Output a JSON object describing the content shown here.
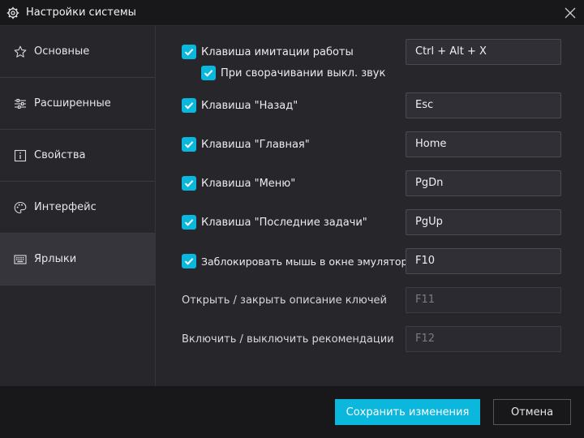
{
  "window": {
    "title": "Настройки системы",
    "icons": {
      "settings": "gear-icon",
      "close": "close-icon"
    }
  },
  "sidebar": {
    "items": [
      {
        "label": "Основные",
        "icon": "star-icon",
        "active": false
      },
      {
        "label": "Расширенные",
        "icon": "sliders-icon",
        "active": false
      },
      {
        "label": "Свойства",
        "icon": "info-icon",
        "active": false
      },
      {
        "label": "Интерфейс",
        "icon": "palette-icon",
        "active": false
      },
      {
        "label": "Ярлыки",
        "icon": "keyboard-icon",
        "active": true
      }
    ]
  },
  "shortcuts": {
    "boss_key": {
      "label": "Клавиша имитации работы",
      "checked": true,
      "value": "Ctrl + Alt + X"
    },
    "mute_on_minimize": {
      "label": "При сворачивании выкл. звук",
      "checked": true
    },
    "back": {
      "label": "Клавиша \"Назад\"",
      "checked": true,
      "value": "Esc"
    },
    "home": {
      "label": "Клавиша \"Главная\"",
      "checked": true,
      "value": "Home"
    },
    "menu": {
      "label": "Клавиша \"Меню\"",
      "checked": true,
      "value": "PgDn"
    },
    "recent": {
      "label": "Клавиша \"Последние задачи\"",
      "checked": true,
      "value": "PgUp"
    },
    "lock_mouse": {
      "label": "Заблокировать мышь в окне эмулятора",
      "checked": true,
      "value": "F10"
    },
    "key_description": {
      "label": "Открыть / закрыть описание ключей",
      "value": "F11",
      "enabled": false
    },
    "recommendations": {
      "label": "Включить / выключить рекомендации",
      "value": "F12",
      "enabled": false
    }
  },
  "footer": {
    "save_label": "Сохранить изменения",
    "cancel_label": "Отмена"
  },
  "colors": {
    "accent": "#0bb7dc",
    "background": "#26262b",
    "titlebar": "#18181b",
    "active_nav": "#35353b"
  }
}
